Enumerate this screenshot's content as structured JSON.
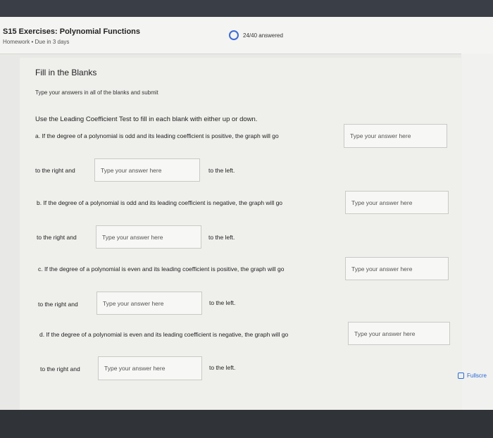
{
  "header": {
    "title": "S15 Exercises: Polynomial Functions",
    "subtitle": "Homework  •  Due in 3 days",
    "progress": "24/40 answered"
  },
  "card": {
    "heading": "Fill in the Blanks",
    "instructions": "Type your answers in all of the blanks and submit",
    "intro": "Use the Leading Coefficient Test to fill in each blank with either up or down.",
    "placeholder": "Type your answer here",
    "right_label": "to the right and",
    "left_label": "to the left.",
    "questions": [
      {
        "text": "a. If the degree of a polynomial is odd and its leading coefficient is positive, the graph will go"
      },
      {
        "text": "b. If the degree of a polynomial is odd and its leading coefficient is negative, the graph will go"
      },
      {
        "text": "c. If the degree of a polynomial is even and its leading coefficient is positive, the graph will go"
      },
      {
        "text": "d. If the degree of a polynomial is even and its leading coefficient is negative, the graph will go"
      }
    ]
  },
  "fullscreen_label": "Fullscre"
}
